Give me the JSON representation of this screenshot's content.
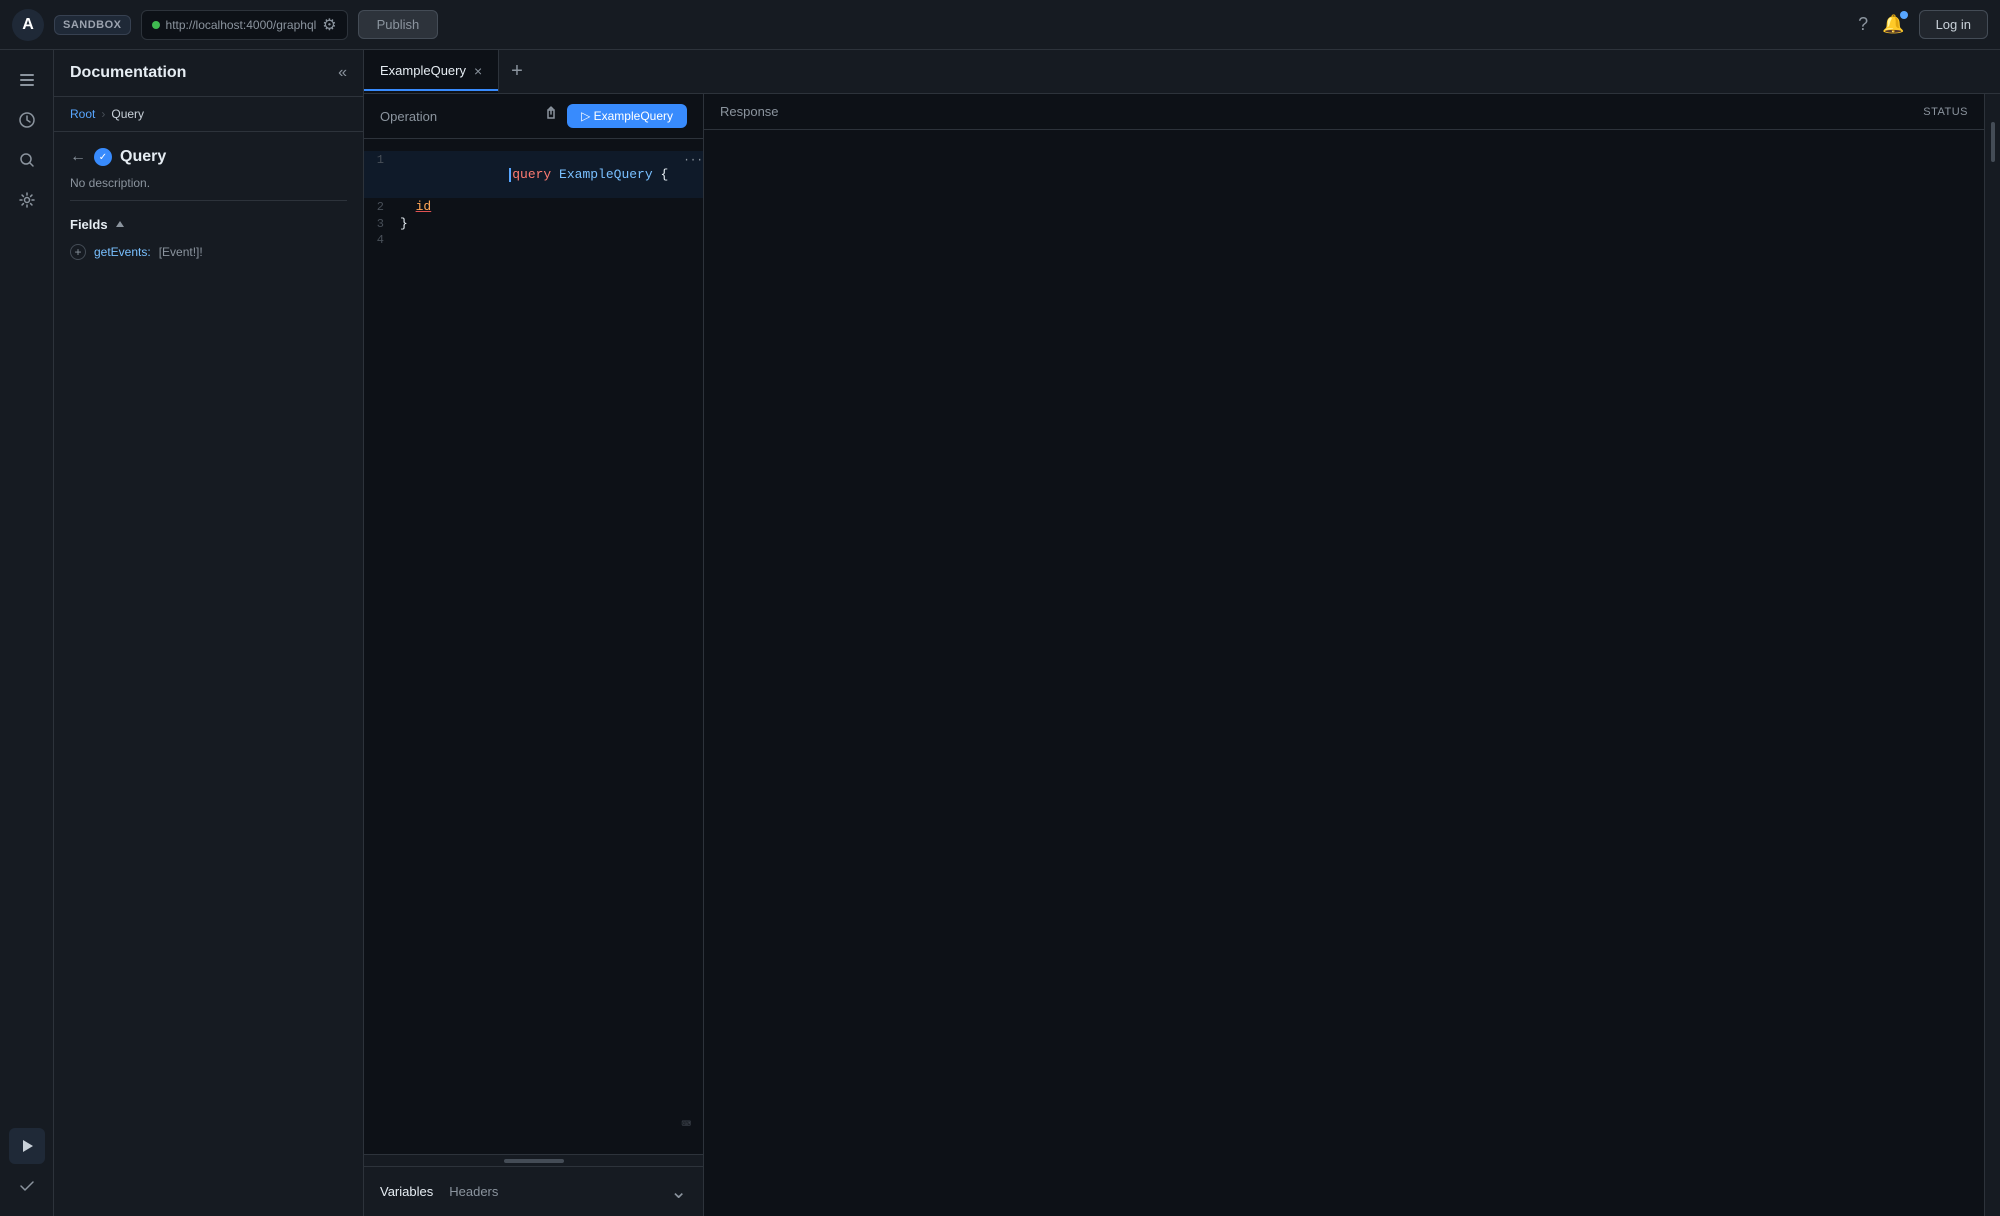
{
  "topbar": {
    "logo": "A",
    "sandbox_label": "SANDBOX",
    "url": "http://localhost:4000/graphql",
    "publish_label": "Publish",
    "login_label": "Log in"
  },
  "icon_sidebar": {
    "items": [
      {
        "name": "operations-icon",
        "symbol": "☰",
        "active": false
      },
      {
        "name": "history-icon",
        "symbol": "⟳",
        "active": false
      },
      {
        "name": "search-icon",
        "symbol": "🔍",
        "active": false
      },
      {
        "name": "settings-icon",
        "symbol": "⚙",
        "active": false
      },
      {
        "name": "docs-icon",
        "symbol": "▶",
        "active": true
      },
      {
        "name": "check-icon",
        "symbol": "✓",
        "active": false
      }
    ]
  },
  "docs_panel": {
    "title": "Documentation",
    "breadcrumb": {
      "root": "Root",
      "separator": "›",
      "current": "Query"
    },
    "query": {
      "name": "Query",
      "description": "No description.",
      "fields_label": "Fields",
      "fields": [
        {
          "name": "getEvents:",
          "type": "[Event!]!"
        }
      ]
    }
  },
  "tabs": [
    {
      "label": "ExampleQuery",
      "active": true
    },
    {
      "label": "+",
      "add": true
    }
  ],
  "editor": {
    "operation_label": "Operation",
    "run_button": "▷ ExampleQuery",
    "code_lines": [
      {
        "num": "1",
        "content_parts": [
          {
            "text": "query ",
            "class": "code-keyword"
          },
          {
            "text": "ExampleQuery",
            "class": "code-name"
          },
          {
            "text": " {",
            "class": "code-punctuation"
          }
        ],
        "has_cursor": true,
        "dots": "···"
      },
      {
        "num": "2",
        "content_parts": [
          {
            "text": "  id",
            "class": "code-field"
          }
        ]
      },
      {
        "num": "3",
        "content_parts": [
          {
            "text": "}",
            "class": "code-punctuation"
          }
        ]
      },
      {
        "num": "4",
        "content_parts": []
      }
    ]
  },
  "variables": {
    "label": "Variables",
    "headers_label": "Headers"
  },
  "response": {
    "title": "Response",
    "status_label": "STATUS"
  }
}
